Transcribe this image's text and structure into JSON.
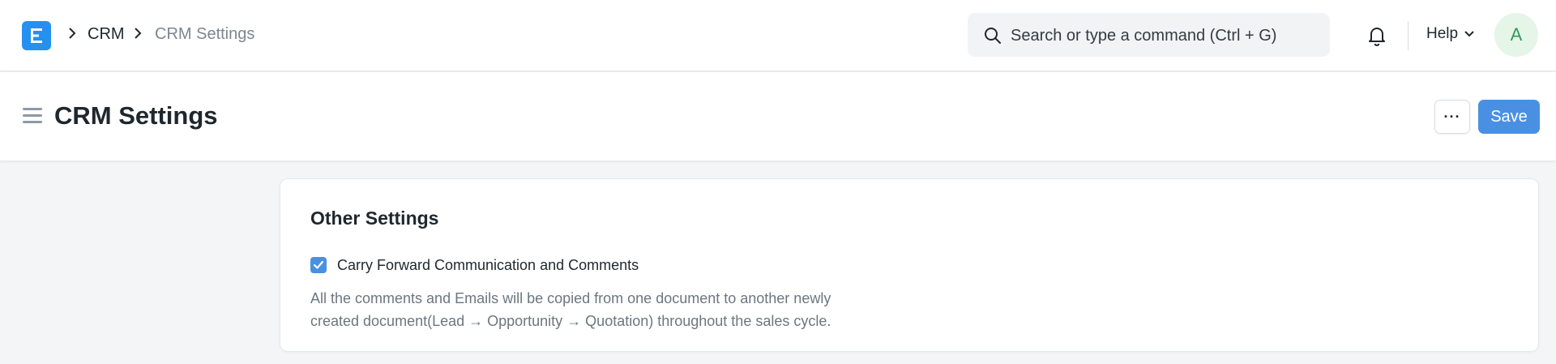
{
  "navbar": {
    "logo": "frappe-e-logo",
    "breadcrumbs": [
      "CRM",
      "CRM Settings"
    ],
    "search_placeholder": "Search or type a command (Ctrl + G)",
    "help_label": "Help",
    "avatar_initial": "A"
  },
  "page_head": {
    "title": "CRM Settings",
    "more_label": "···",
    "save_label": "Save"
  },
  "card": {
    "section_title": "Other Settings",
    "checkbox": {
      "label": "Carry Forward Communication and Comments",
      "checked": true
    },
    "description_line1": "All the comments and Emails will be copied from one document to another newly",
    "description_line2": "created document(Lead → Opportunity → Quotation) throughout the sales cycle."
  },
  "colors": {
    "primary": "#4a90e2",
    "logo": "#2490ef",
    "avatar_bg": "#e5f5e8",
    "avatar_fg": "#2f9d58",
    "page_bg": "#f4f5f6"
  }
}
